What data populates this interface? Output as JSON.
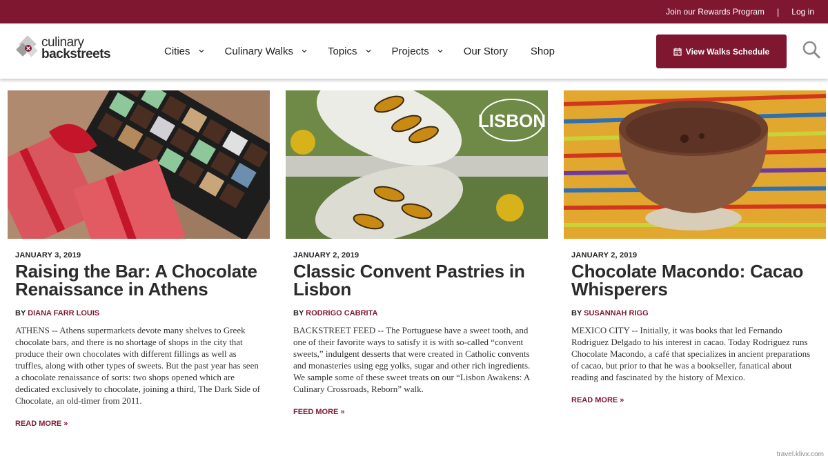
{
  "topbar": {
    "rewards_label": "Join our Rewards Program",
    "separator": "|",
    "login_label": "Log in"
  },
  "logo": {
    "line1": "culinary",
    "line2": "backstreets"
  },
  "nav": {
    "items": [
      {
        "label": "Cities",
        "dropdown": true
      },
      {
        "label": "Culinary Walks",
        "dropdown": true
      },
      {
        "label": "Topics",
        "dropdown": true
      },
      {
        "label": "Projects",
        "dropdown": true
      },
      {
        "label": "Our Story",
        "dropdown": false
      },
      {
        "label": "Shop",
        "dropdown": false
      }
    ]
  },
  "walks_button": {
    "label": "View Walks Schedule",
    "icon": "calendar-icon"
  },
  "search": {
    "icon": "search-icon"
  },
  "colors": {
    "brand": "#7f1731",
    "text": "#2b2b2b"
  },
  "articles": [
    {
      "date": "JANUARY 3, 2019",
      "title": "Raising the Bar: A Chocolate Renaissance in Athens",
      "by": "BY",
      "author": "DIANA FARR LOUIS",
      "excerpt": "ATHENS -- Athens supermarkets devote many shelves to Greek chocolate bars, and there is no shortage of shops in the city that produce their own chocolates with different fillings as well as truffles, along with other types of sweets. But the past year has seen a chocolate renaissance of sorts: two shops opened which are dedicated exclusively to chocolate, joining a third, The Dark Side of Chocolate, an old-timer from 2011.",
      "read_more": "READ MORE »"
    },
    {
      "date": "JANUARY 2, 2019",
      "title": "Classic Convent Pastries in Lisbon",
      "by": "BY",
      "author": "RODRIGO CABRITA",
      "excerpt": "BACKSTREET FEED -- The Portuguese have a sweet tooth, and one of their favorite ways to satisfy it is with so-called “convent sweets,” indulgent desserts that were created in Catholic convents and monasteries using egg yolks, sugar and other rich ingredients. We sample some of these sweet treats on our “Lisbon Awakens: A Culinary Crossroads, Reborn” walk.",
      "read_more": "FEED MORE »",
      "image_text": "LISBON"
    },
    {
      "date": "JANUARY 2, 2019",
      "title": "Chocolate Macondo: Cacao Whisperers",
      "by": "BY",
      "author": "SUSANNAH RIGG",
      "excerpt": "MEXICO CITY -- Initially, it was books that led Fernando Rodriguez Delgado to his interest in cacao. Today Rodriguez runs Chocolate Macondo, a café that specializes in ancient preparations of cacao, but prior to that he was a bookseller, fanatical about reading and fascinated by the history of Mexico.",
      "read_more": "READ MORE »"
    }
  ],
  "watermark": "travel.klivx.com"
}
